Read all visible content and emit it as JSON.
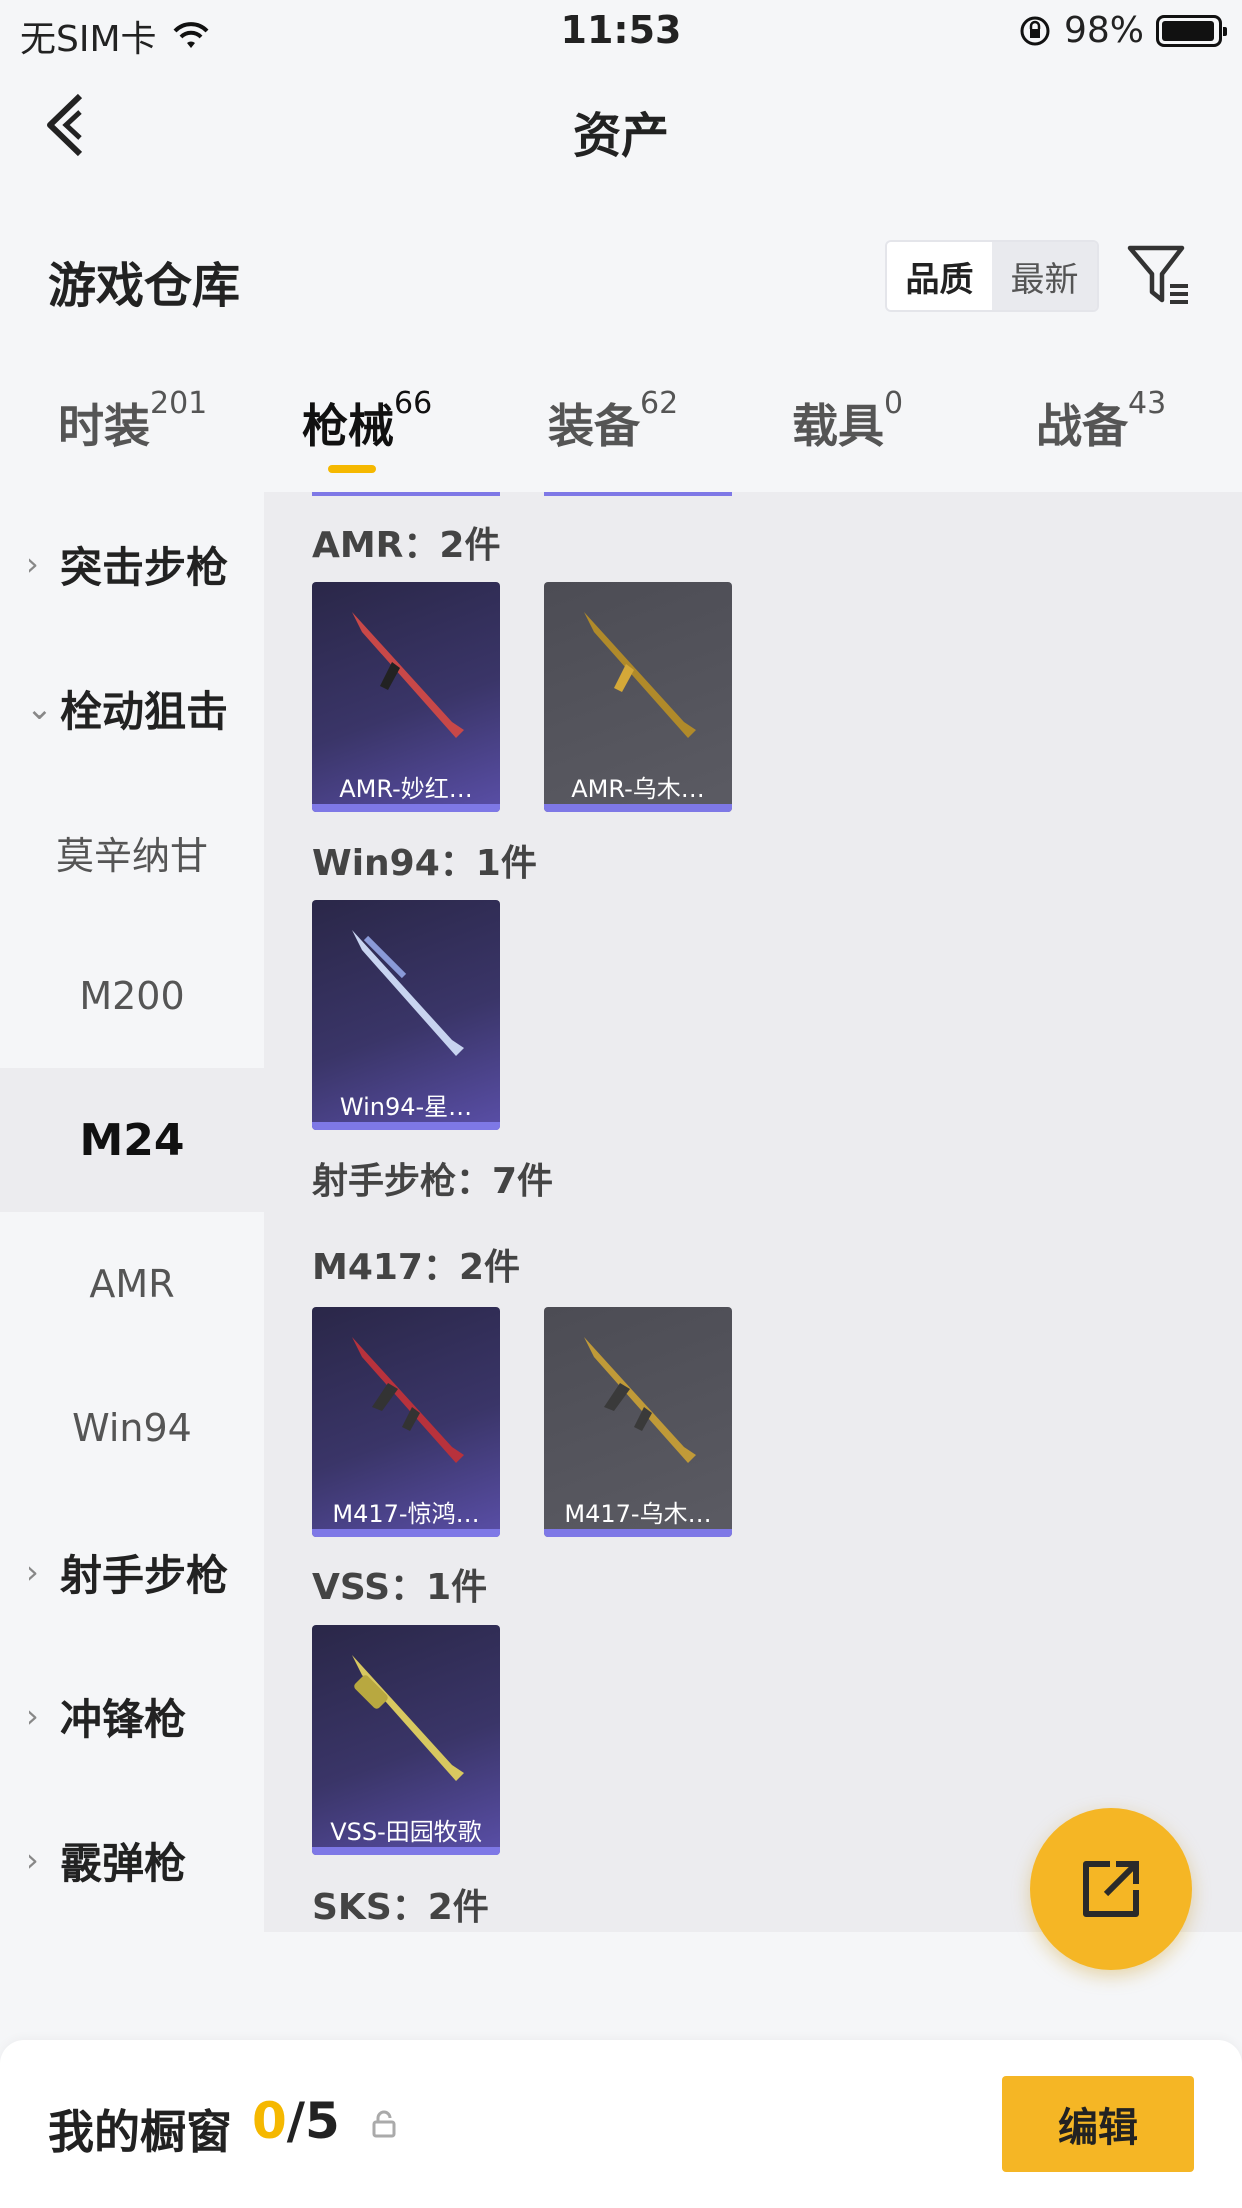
{
  "status": {
    "carrier": "无SIM卡",
    "time": "11:53",
    "battery": "98%"
  },
  "nav": {
    "title": "资产"
  },
  "section": {
    "title": "游戏仓库",
    "sort_quality": "品质",
    "sort_newest": "最新"
  },
  "tabs": [
    {
      "label": "时装",
      "count": "201"
    },
    {
      "label": "枪械",
      "count": "66"
    },
    {
      "label": "装备",
      "count": "62"
    },
    {
      "label": "载具",
      "count": "0"
    },
    {
      "label": "战备",
      "count": "43"
    }
  ],
  "sidebar": {
    "items": [
      {
        "label": "突击步枪",
        "type": "group",
        "chevron": "›"
      },
      {
        "label": "栓动狙击",
        "type": "group",
        "chevron": "⌄"
      },
      {
        "label": "莫辛纳甘",
        "type": "sub"
      },
      {
        "label": "M200",
        "type": "sub"
      },
      {
        "label": "M24",
        "type": "sub",
        "selected": true
      },
      {
        "label": "AMR",
        "type": "sub"
      },
      {
        "label": "Win94",
        "type": "sub"
      },
      {
        "label": "射手步枪",
        "type": "group",
        "chevron": "›"
      },
      {
        "label": "冲锋枪",
        "type": "group",
        "chevron": "›"
      },
      {
        "label": "霰弹枪",
        "type": "group",
        "chevron": "›"
      }
    ]
  },
  "content": {
    "categories": [
      {
        "label": "AMR：2件"
      },
      {
        "label": "Win94：1件"
      },
      {
        "label": "射手步枪：7件"
      },
      {
        "label": "M417：2件"
      },
      {
        "label": "VSS：1件"
      },
      {
        "label": "SKS：2件"
      }
    ],
    "cards": [
      {
        "name": "AMR-妙红…",
        "color": "#c84848"
      },
      {
        "name": "AMR-乌木…",
        "color": "#b08a2a"
      },
      {
        "name": "Win94-星…",
        "color": "#c8d4f0"
      },
      {
        "name": "M417-惊鸿…",
        "color": "#b8323c"
      },
      {
        "name": "M417-乌木…",
        "color": "#c09a38"
      },
      {
        "name": "VSS-田园牧歌",
        "color": "#d8c860"
      }
    ]
  },
  "bottom": {
    "title": "我的橱窗",
    "current": "0",
    "total": "/5",
    "edit_label": "编辑"
  },
  "colors": {
    "accent": "#f5b625",
    "card_purple": "#3a3568",
    "card_gray": "#55555d",
    "card_bar": "#7e78e6"
  }
}
